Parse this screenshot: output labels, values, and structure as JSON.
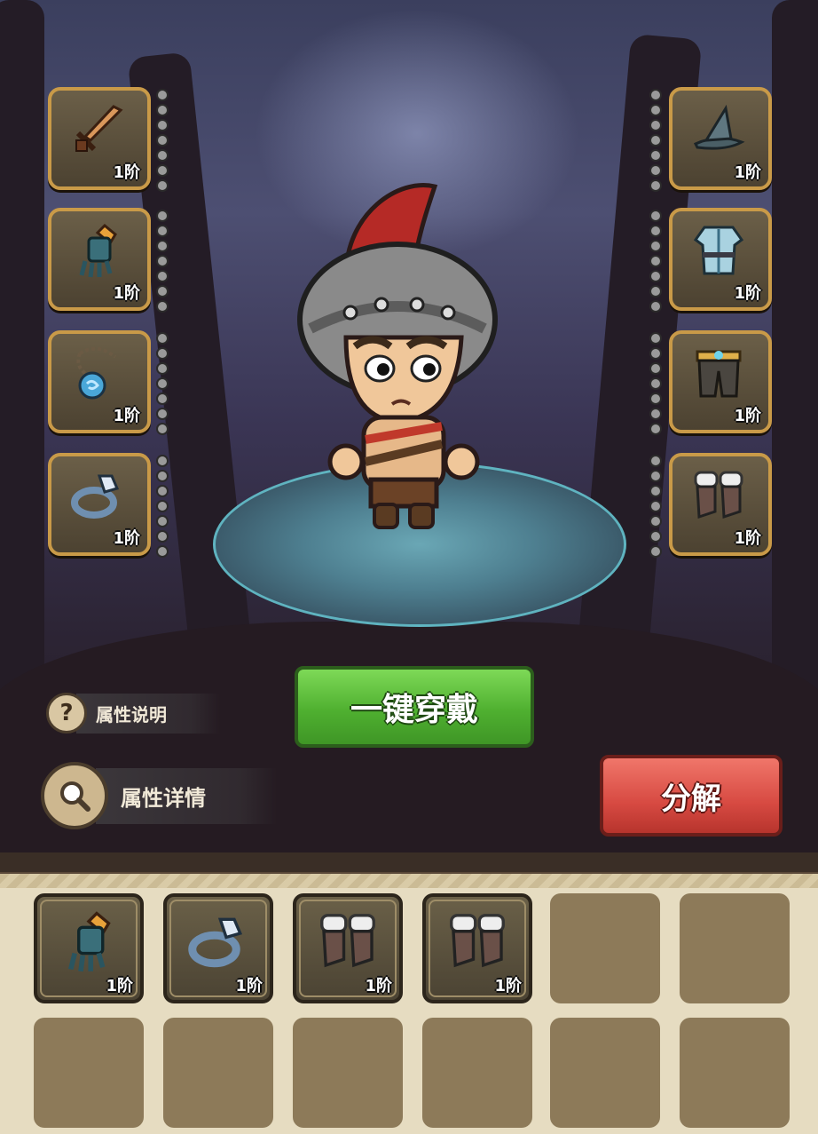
{
  "equipment_left": [
    {
      "icon": "sword-icon",
      "tier": "1阶"
    },
    {
      "icon": "gauntlet-icon",
      "tier": "1阶"
    },
    {
      "icon": "amulet-icon",
      "tier": "1阶"
    },
    {
      "icon": "ring-icon",
      "tier": "1阶"
    }
  ],
  "equipment_right": [
    {
      "icon": "wizard-hat-icon",
      "tier": "1阶"
    },
    {
      "icon": "tunic-icon",
      "tier": "1阶"
    },
    {
      "icon": "pants-icon",
      "tier": "1阶"
    },
    {
      "icon": "fur-boots-icon",
      "tier": "1阶"
    }
  ],
  "buttons": {
    "equip_all": "一键穿戴",
    "decompose": "分解",
    "attr_explain": "属性说明",
    "attr_detail": "属性详情"
  },
  "inventory": [
    {
      "icon": "gauntlet-icon",
      "tier": "1阶"
    },
    {
      "icon": "ring-icon",
      "tier": "1阶"
    },
    {
      "icon": "fur-boots-icon",
      "tier": "1阶"
    },
    {
      "icon": "fur-boots-icon",
      "tier": "1阶"
    }
  ],
  "colors": {
    "slot_border": "#c99a48",
    "equip_button": "#4fb030",
    "decompose_button": "#d74a42",
    "panel": "#e6dcc1"
  }
}
